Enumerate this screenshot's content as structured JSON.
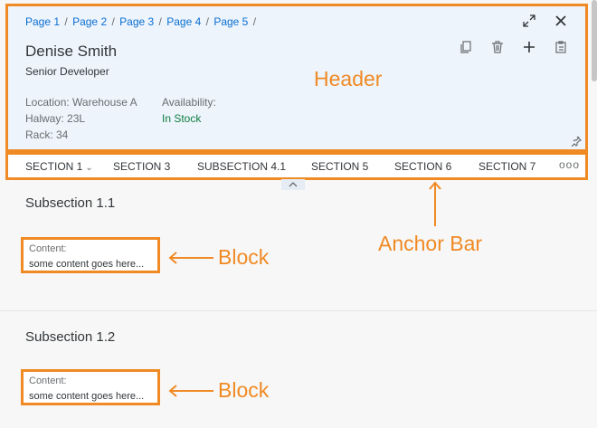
{
  "breadcrumb": [
    "Page 1",
    "Page 2",
    "Page 3",
    "Page 4",
    "Page 5"
  ],
  "breadcrumb_separator": "/",
  "header": {
    "title": "Denise Smith",
    "subtitle": "Senior Developer",
    "attributes_left": [
      "Location: Warehouse A",
      "Halway: 23L",
      "Rack: 34"
    ],
    "availability_label": "Availability:",
    "availability_value": "In Stock",
    "annotation": "Header"
  },
  "toolbar_icons": [
    "expand-icon",
    "close-icon",
    "copy-icon",
    "delete-icon",
    "add-icon",
    "paste-icon",
    "pin-icon"
  ],
  "anchor_bar": {
    "items": [
      "SECTION 1",
      "SECTION 3",
      "SUBSECTION 4.1",
      "SECTION 5",
      "SECTION 6",
      "SECTION 7"
    ],
    "more": "ooo",
    "annotation": "Anchor Bar"
  },
  "sections": [
    {
      "title": "Subsection 1.1",
      "block_label": "Content:",
      "block_value": "some content goes here..."
    },
    {
      "title": "Subsection 1.2",
      "block_label": "Content:",
      "block_value": "some content goes here..."
    }
  ],
  "block_annotation": "Block",
  "colors": {
    "accent": "#f08a24",
    "link": "#0a6ed1",
    "success": "#107e3e",
    "header_bg": "#edf4fc"
  }
}
